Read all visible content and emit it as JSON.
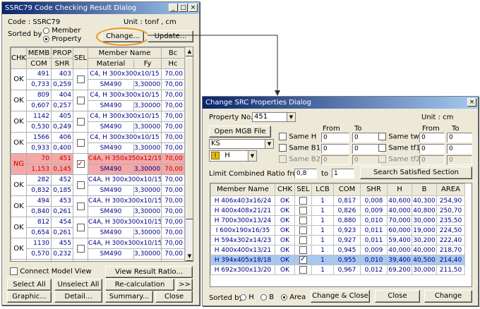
{
  "left": {
    "title": "SSRC79 Code Checking Result Dialog",
    "code_text": "Code : SSRC79",
    "unit_text": "Unit : tonf ,   cm",
    "sorted_by": "Sorted by",
    "sort_member": "Member",
    "sort_property": "Property",
    "change_btn": "Change...",
    "update_btn": "Update...",
    "headers": {
      "chk": "CHK",
      "memb": "MEMB",
      "com": "COM",
      "prop": "PROP",
      "shr": "SHR",
      "sel": "SEL",
      "member_name": "Member Name",
      "material": "Material",
      "fy": "Fy",
      "bc": "Bc",
      "hc": "Hc"
    },
    "rows": [
      {
        "chk": "OK",
        "memb": "491",
        "prop": "403",
        "name": "C4, H 300x300x10/15",
        "bc": "70,00",
        "com": "0,733",
        "shr": "0,259",
        "mat": "SM490",
        "fy": "3,30000",
        "hc": "70,00",
        "selected": false,
        "ng": false
      },
      {
        "chk": "OK",
        "memb": "809",
        "prop": "404",
        "name": "C4, H 300x300x10/15",
        "bc": "70,00",
        "com": "0,607",
        "shr": "0,257",
        "mat": "SM490",
        "fy": "3,30000",
        "hc": "70,00",
        "selected": false,
        "ng": false
      },
      {
        "chk": "OK",
        "memb": "1142",
        "prop": "405",
        "name": "C4, H 300x300x10/15",
        "bc": "70,00",
        "com": "0,530",
        "shr": "0,249",
        "mat": "SM490",
        "fy": "3,30000",
        "hc": "70,00",
        "selected": false,
        "ng": false
      },
      {
        "chk": "OK",
        "memb": "1566",
        "prop": "406",
        "name": "C4, H 300x300x10/15",
        "bc": "70,00",
        "com": "0,933",
        "shr": "0,400",
        "mat": "SM490",
        "fy": "3,30000",
        "hc": "70,00",
        "selected": false,
        "ng": false
      },
      {
        "chk": "NG",
        "memb": "70",
        "prop": "451",
        "name": "C4A, H 350x350x12/19",
        "bc": "70,00",
        "com": "1,153",
        "shr": "0,145",
        "mat": "SM490",
        "fy": "3,30000",
        "hc": "70,00",
        "selected": true,
        "ng": true
      },
      {
        "chk": "OK",
        "memb": "282",
        "prop": "452",
        "name": "C4A, H 300x300x10/15",
        "bc": "70,00",
        "com": "0,832",
        "shr": "0,185",
        "mat": "SM490",
        "fy": "3,30000",
        "hc": "70,00",
        "selected": false,
        "ng": false
      },
      {
        "chk": "OK",
        "memb": "494",
        "prop": "453",
        "name": "C4A, H 300x300x10/15",
        "bc": "70,00",
        "com": "0,840",
        "shr": "0,261",
        "mat": "SM490",
        "fy": "3,30000",
        "hc": "70,00",
        "selected": false,
        "ng": false
      },
      {
        "chk": "OK",
        "memb": "812",
        "prop": "454",
        "name": "C4A, H 300x300x10/15",
        "bc": "70,00",
        "com": "0,654",
        "shr": "0,261",
        "mat": "SM490",
        "fy": "3,30000",
        "hc": "70,00",
        "selected": false,
        "ng": false
      },
      {
        "chk": "OK",
        "memb": "1130",
        "prop": "455",
        "name": "C4A, H 300x300x10/15",
        "bc": "70,00",
        "com": "0,570",
        "shr": "0,232",
        "mat": "SM490",
        "fy": "3,30000",
        "hc": "70,00",
        "selected": false,
        "ng": false
      },
      {
        "chk": "OK",
        "memb": "1554",
        "prop": "456",
        "name": "C4A, H 300x300x10/15",
        "bc": "70,00",
        "com": "0,977",
        "shr": "0,367",
        "mat": "SM490",
        "fy": "3,30000",
        "hc": "70,00",
        "selected": false,
        "ng": false
      }
    ],
    "connect_model_view": "Connect Model View",
    "view_result_ratio": "View Result Ratio...",
    "select_all": "Select All",
    "unselect_all": "Unselect All",
    "recalculation": "Re-calculation",
    "more": ">>",
    "graphic": "Graphic...",
    "detail": "Detail...",
    "summary": "Summary...",
    "close": "Close"
  },
  "right": {
    "title": "Change SRC Properties Dialog",
    "property_no_label": "Property No.",
    "property_no_value": "451",
    "unit_text": "Unit :    cm",
    "open_mgb": "Open MGB File",
    "from": "From",
    "to": "To",
    "code_value": "KS",
    "shape_value": "H",
    "same_h": "Same H",
    "same_b1": "Same B1",
    "same_b2": "Same B2",
    "same_tw": "Same tw",
    "same_tf1": "Same tf1",
    "same_tf2": "Same tf2",
    "same_h_from": "0",
    "same_h_to": "0",
    "same_b1_from": "0",
    "same_b1_to": "0",
    "same_b2_from": "0",
    "same_b2_to": "0",
    "same_tw_from": "0",
    "same_tw_to": "0",
    "same_tf1_from": "0",
    "same_tf1_to": "0",
    "same_tf2_from": "0",
    "same_tf2_to": "0",
    "limit_label": "Limit Combined Ratio from",
    "limit_from": "0,8",
    "limit_to_label": "to",
    "limit_to": "1",
    "search_btn": "Search Satisfied Section",
    "headers": [
      "Member Name",
      "CHK",
      "SEL",
      "LCB",
      "COM",
      "SHR",
      "H",
      "B",
      "AREA"
    ],
    "rows": [
      {
        "name": "H 406x403x16/24",
        "chk": "OK",
        "sel": false,
        "lcb": "1",
        "com": "0,817",
        "shr": "0,008",
        "h": "40,600",
        "b": "40,300",
        "area": "254,90"
      },
      {
        "name": "H 400x408x21/21",
        "chk": "OK",
        "sel": false,
        "lcb": "1",
        "com": "0,826",
        "shr": "0,009",
        "h": "40,000",
        "b": "40,800",
        "area": "250,70"
      },
      {
        "name": "H 700x300x13/24",
        "chk": "OK",
        "sel": false,
        "lcb": "1",
        "com": "0,880",
        "shr": "0,010",
        "h": "70,000",
        "b": "30,000",
        "area": "235,50"
      },
      {
        "name": "I 600x190x16/35",
        "chk": "OK",
        "sel": false,
        "lcb": "1",
        "com": "0,923",
        "shr": "0,011",
        "h": "60,000",
        "b": "19,000",
        "area": "224,50"
      },
      {
        "name": "H 594x302x14/23",
        "chk": "OK",
        "sel": false,
        "lcb": "1",
        "com": "0,927",
        "shr": "0,011",
        "h": "59,400",
        "b": "30,200",
        "area": "222,40"
      },
      {
        "name": "H 400x400x13/21",
        "chk": "OK",
        "sel": false,
        "lcb": "1",
        "com": "0,945",
        "shr": "0,009",
        "h": "40,000",
        "b": "40,000",
        "area": "218,70"
      },
      {
        "name": "H 394x405x18/18",
        "chk": "OK",
        "sel": true,
        "lcb": "1",
        "com": "0,955",
        "shr": "0,010",
        "h": "39,400",
        "b": "40,500",
        "area": "214,40"
      },
      {
        "name": "H 692x300x13/20",
        "chk": "OK",
        "sel": false,
        "lcb": "1",
        "com": "0,967",
        "shr": "0,012",
        "h": "69,200",
        "b": "30,000",
        "area": "211,50"
      }
    ],
    "sorted_by": "Sorted by",
    "sort_h": "H",
    "sort_b": "B",
    "sort_area": "Area",
    "change_close": "Change & Close",
    "close": "Close",
    "change": "Change"
  },
  "colors": {
    "highlight_orange": "#f0961e",
    "ng_red": "#c00000",
    "title_blue": "#0a246a",
    "selected_row": "#a8c8f0"
  }
}
